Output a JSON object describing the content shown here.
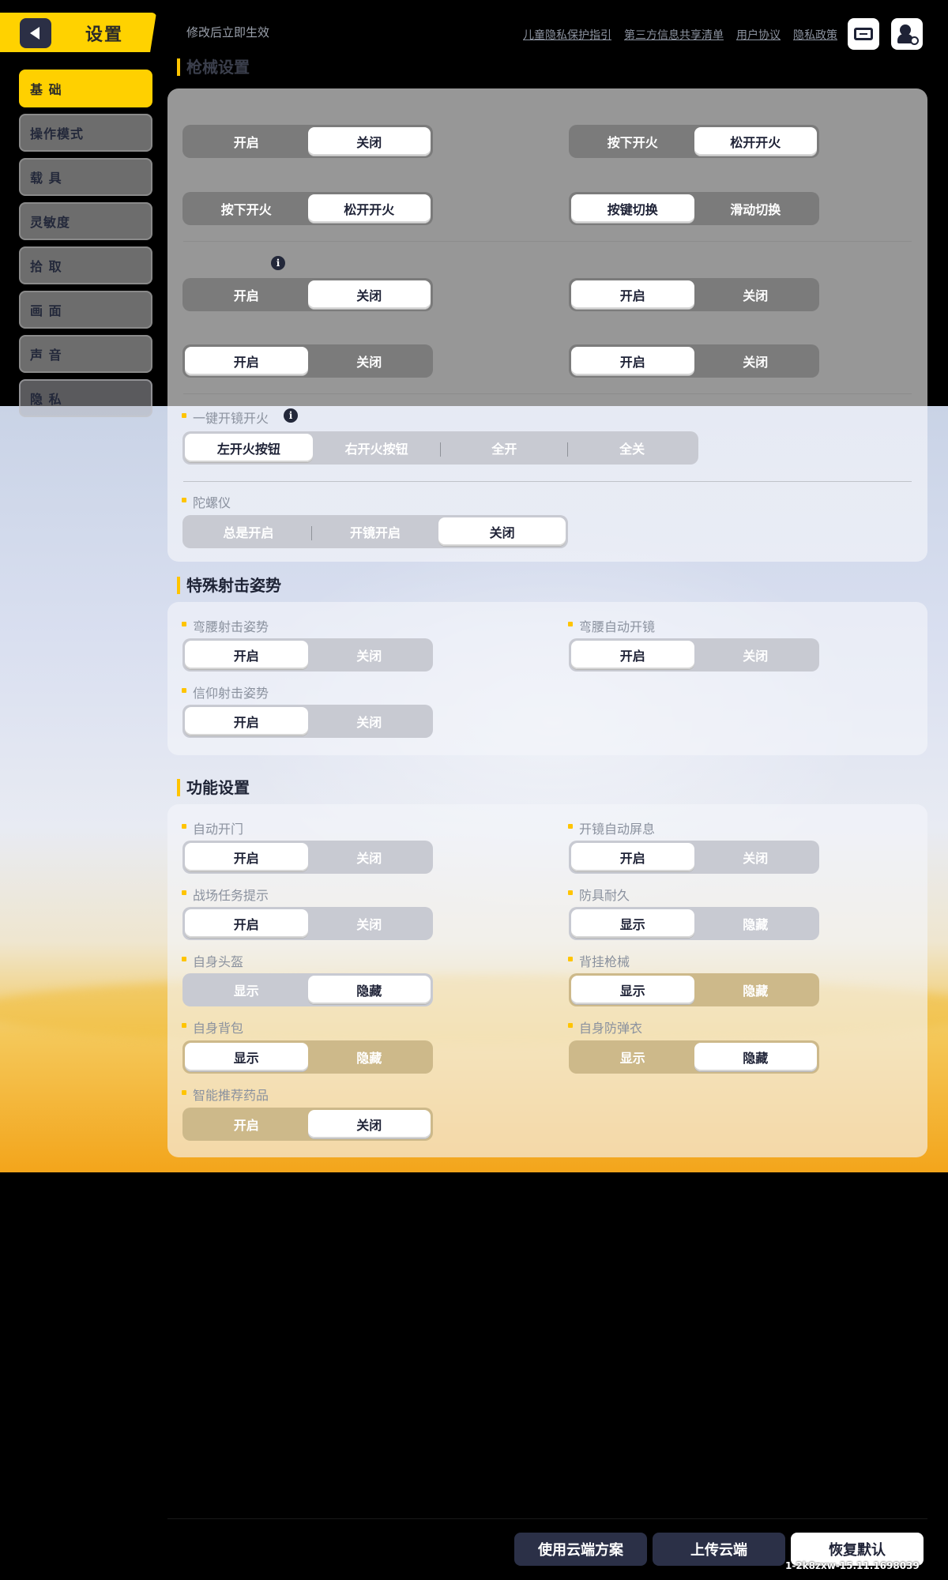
{
  "header": {
    "title": "设置",
    "notice": "修改后立即生效",
    "links": [
      "儿童隐私保护指引",
      "第三方信息共享清单",
      "用户协议",
      "隐私政策"
    ]
  },
  "sidebar": {
    "items": [
      {
        "label": "基 础",
        "active": true
      },
      {
        "label": "操作模式"
      },
      {
        "label": "载 具"
      },
      {
        "label": "灵敏度"
      },
      {
        "label": "拾 取"
      },
      {
        "label": "画 面"
      },
      {
        "label": "声 音"
      },
      {
        "label": "隐 私"
      }
    ]
  },
  "gun": {
    "title": "枪械设置",
    "rows": [
      {
        "left": {
          "options": [
            "开启",
            "关闭"
          ],
          "selected": 1
        },
        "right": {
          "options": [
            "按下开火",
            "松开开火"
          ],
          "selected": 1
        }
      },
      {
        "left": {
          "options": [
            "按下开火",
            "松开开火"
          ],
          "selected": 1
        },
        "right": {
          "options": [
            "按键切换",
            "滑动切换"
          ],
          "selected": 0
        }
      },
      {
        "left": {
          "options": [
            "开启",
            "关闭"
          ],
          "selected": 1
        },
        "right": {
          "options": [
            "开启",
            "关闭"
          ],
          "selected": 0
        }
      },
      {
        "left": {
          "options": [
            "开启",
            "关闭"
          ],
          "selected": 0
        },
        "right": {
          "options": [
            "开启",
            "关闭"
          ],
          "selected": 0
        }
      }
    ],
    "one_key": {
      "label": "一键开镜开火",
      "options": [
        "左开火按钮",
        "右开火按钮",
        "全开",
        "全关"
      ],
      "selected": 0
    },
    "gyro": {
      "label": "陀螺仪",
      "options": [
        "总是开启",
        "开镜开启",
        "关闭"
      ],
      "selected": 2
    }
  },
  "special": {
    "title": "特殊射击姿势",
    "items": [
      {
        "label": "弯腰射击姿势",
        "options": [
          "开启",
          "关闭"
        ],
        "selected": 0
      },
      {
        "label": "弯腰自动开镜",
        "options": [
          "开启",
          "关闭"
        ],
        "selected": 0
      },
      {
        "label": "信仰射击姿势",
        "options": [
          "开启",
          "关闭"
        ],
        "selected": 0
      }
    ]
  },
  "func": {
    "title": "功能设置",
    "items": [
      {
        "label": "自动开门",
        "options": [
          "开启",
          "关闭"
        ],
        "selected": 0
      },
      {
        "label": "开镜自动屏息",
        "options": [
          "开启",
          "关闭"
        ],
        "selected": 0
      },
      {
        "label": "战场任务提示",
        "options": [
          "开启",
          "关闭"
        ],
        "selected": 0
      },
      {
        "label": "防具耐久",
        "options": [
          "显示",
          "隐藏"
        ],
        "selected": 0
      },
      {
        "label": "自身头盔",
        "options": [
          "显示",
          "隐藏"
        ],
        "selected": 1
      },
      {
        "label": "背挂枪械",
        "options": [
          "显示",
          "隐藏"
        ],
        "selected": 0
      },
      {
        "label": "自身背包",
        "options": [
          "显示",
          "隐藏"
        ],
        "selected": 0
      },
      {
        "label": "自身防弹衣",
        "options": [
          "显示",
          "隐藏"
        ],
        "selected": 1
      },
      {
        "label": "智能推荐药品",
        "options": [
          "开启",
          "关闭"
        ],
        "selected": 1
      }
    ]
  },
  "footer": {
    "cloud_use": "使用云端方案",
    "cloud_upload": "上传云端",
    "restore": "恢复默认",
    "version": "1-2k8zxw-15.11.1698039"
  },
  "icons": {
    "back": "back-arrow-icon",
    "ticket": "ticket-icon",
    "user": "user-settings-icon"
  },
  "colors": {
    "accent": "#ffd200",
    "dark": "#2b3047"
  }
}
